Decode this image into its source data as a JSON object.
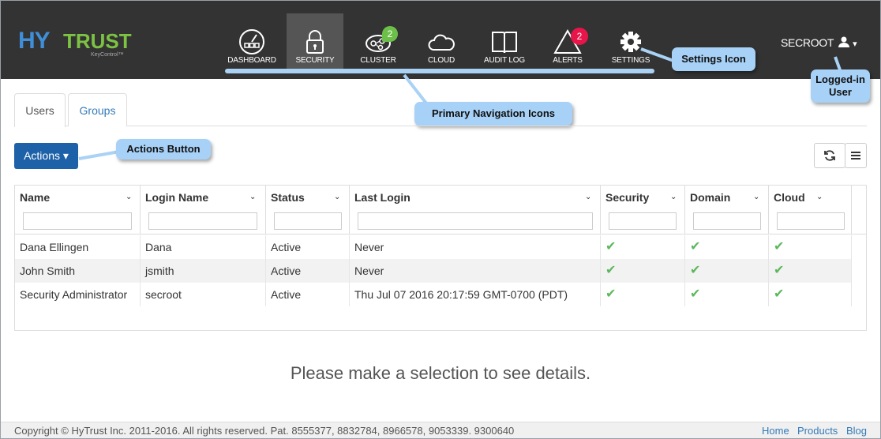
{
  "brand": {
    "logo_hy": "HY",
    "logo_trust": "TRUST",
    "logo_sub": "KeyControl™"
  },
  "nav": [
    {
      "id": "dashboard",
      "label": "DASHBOARD",
      "icon": "dashboard-gauge-icon"
    },
    {
      "id": "security",
      "label": "SECURITY",
      "icon": "lock-icon",
      "active": true
    },
    {
      "id": "cluster",
      "label": "CLUSTER",
      "icon": "cluster-icon",
      "badge": "2",
      "badge_color": "#6cc04a"
    },
    {
      "id": "cloud",
      "label": "CLOUD",
      "icon": "cloud-icon"
    },
    {
      "id": "audit_log",
      "label": "AUDIT LOG",
      "icon": "book-icon"
    },
    {
      "id": "alerts",
      "label": "ALERTS",
      "icon": "alert-triangle-icon",
      "badge": "2",
      "badge_color": "#e8154a"
    },
    {
      "id": "settings",
      "label": "SETTINGS",
      "icon": "gear-icon"
    }
  ],
  "user": {
    "name": "SECROOT",
    "icon": "user-icon",
    "caret": "▾"
  },
  "callouts": {
    "settings_icon": "Settings Icon",
    "logged_in_user_line1": "Logged-in",
    "logged_in_user_line2": "User",
    "primary_nav": "Primary Navigation Icons",
    "actions_button": "Actions Button"
  },
  "tabs": [
    {
      "label": "Users",
      "active": true
    },
    {
      "label": "Groups",
      "active": false
    }
  ],
  "toolbar": {
    "actions_label": "Actions ▾",
    "refresh_icon": "refresh-icon",
    "columns_icon": "hamburger-menu-icon"
  },
  "table": {
    "columns": [
      "Name",
      "Login Name",
      "Status",
      "Last Login",
      "Security",
      "Domain",
      "Cloud"
    ],
    "rows": [
      {
        "name": "Dana Ellingen",
        "login": "Dana",
        "status": "Active",
        "last_login": "Never",
        "security": "✔",
        "domain": "✔",
        "cloud": "✔"
      },
      {
        "name": "John Smith",
        "login": "jsmith",
        "status": "Active",
        "last_login": "Never",
        "security": "✔",
        "domain": "✔",
        "cloud": "✔"
      },
      {
        "name": "Security Administrator",
        "login": "secroot",
        "status": "Active",
        "last_login": "Thu Jul 07 2016 20:17:59 GMT-0700 (PDT)",
        "security": "✔",
        "domain": "✔",
        "cloud": "✔"
      }
    ]
  },
  "detail": {
    "empty_message": "Please make a selection to see details."
  },
  "footer": {
    "copyright": "Copyright © HyTrust Inc. 2011-2016. All rights reserved. Pat. 8555377, 8832784, 8966578, 9053339. 9300640",
    "links": [
      "Home",
      "Products",
      "Blog"
    ]
  },
  "colors": {
    "topbar": "#333333",
    "accent": "#1d61a8",
    "callout": "#a7d1f6",
    "check": "#5cb85c"
  }
}
